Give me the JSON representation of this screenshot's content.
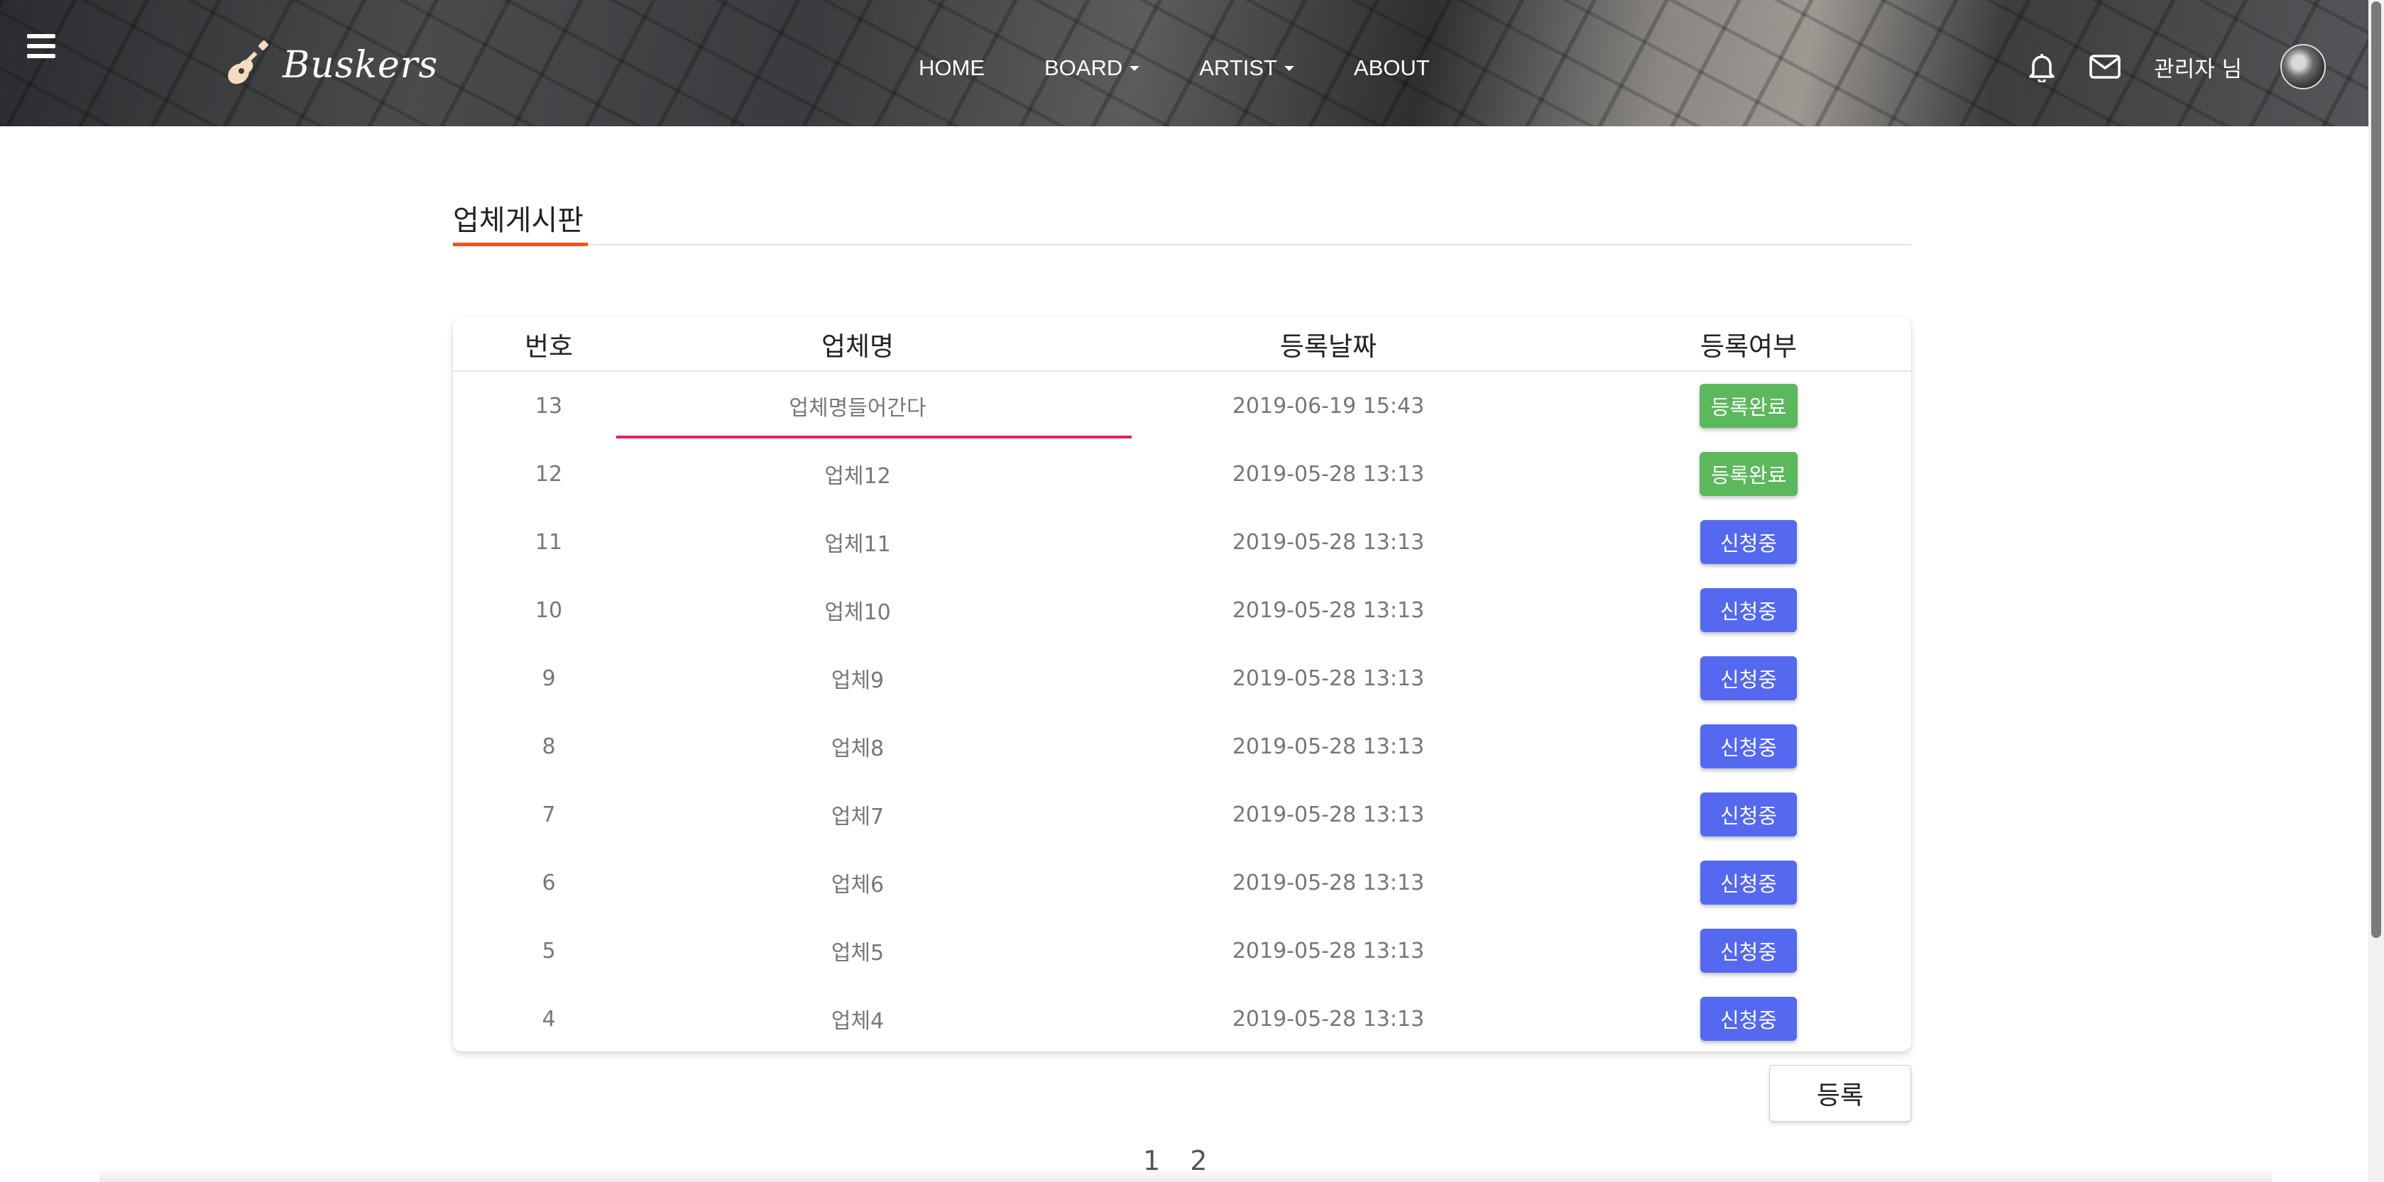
{
  "header": {
    "logo_text": "Buskers",
    "nav": [
      {
        "label": "HOME",
        "dropdown": false
      },
      {
        "label": "BOARD",
        "dropdown": true
      },
      {
        "label": "ARTIST",
        "dropdown": true
      },
      {
        "label": "ABOUT",
        "dropdown": false
      }
    ],
    "user_name": "관리자 님",
    "icons": [
      "menu-icon",
      "guitar-icon",
      "bell-icon",
      "mail-icon",
      "avatar"
    ]
  },
  "page": {
    "title": "업체게시판"
  },
  "table": {
    "columns": [
      "번호",
      "업체명",
      "등록날짜",
      "등록여부"
    ],
    "rows": [
      {
        "num": "13",
        "name": "업체명들어간다",
        "date": "2019-06-19 15:43",
        "status": "등록완료",
        "status_type": "done"
      },
      {
        "num": "12",
        "name": "업체12",
        "date": "2019-05-28 13:13",
        "status": "등록완료",
        "status_type": "done"
      },
      {
        "num": "11",
        "name": "업체11",
        "date": "2019-05-28 13:13",
        "status": "신청중",
        "status_type": "pending"
      },
      {
        "num": "10",
        "name": "업체10",
        "date": "2019-05-28 13:13",
        "status": "신청중",
        "status_type": "pending"
      },
      {
        "num": "9",
        "name": "업체9",
        "date": "2019-05-28 13:13",
        "status": "신청중",
        "status_type": "pending"
      },
      {
        "num": "8",
        "name": "업체8",
        "date": "2019-05-28 13:13",
        "status": "신청중",
        "status_type": "pending"
      },
      {
        "num": "7",
        "name": "업체7",
        "date": "2019-05-28 13:13",
        "status": "신청중",
        "status_type": "pending"
      },
      {
        "num": "6",
        "name": "업체6",
        "date": "2019-05-28 13:13",
        "status": "신청중",
        "status_type": "pending"
      },
      {
        "num": "5",
        "name": "업체5",
        "date": "2019-05-28 13:13",
        "status": "신청중",
        "status_type": "pending"
      },
      {
        "num": "4",
        "name": "업체4",
        "date": "2019-05-28 13:13",
        "status": "신청중",
        "status_type": "pending"
      }
    ]
  },
  "actions": {
    "register_label": "등록"
  },
  "pagination": {
    "pages": [
      "1",
      "2"
    ]
  },
  "colors": {
    "done": "#5cb85c",
    "pending": "#5468f0",
    "accent": "#f4511e",
    "row_highlight": "#e91e63"
  }
}
